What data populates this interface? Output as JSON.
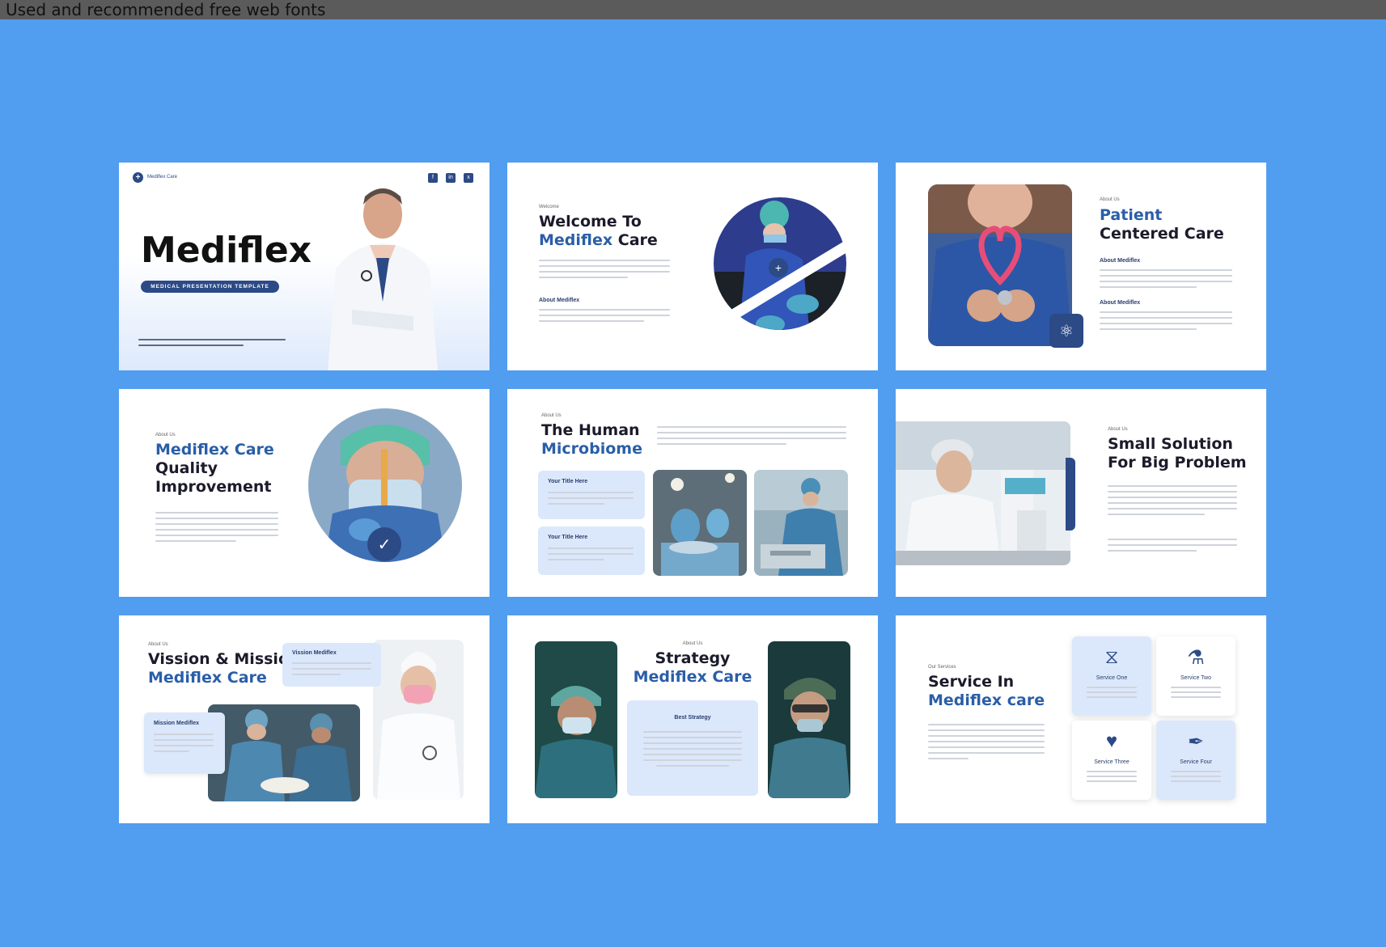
{
  "header": {
    "title": "Used and recommended free web fonts"
  },
  "colors": {
    "background": "#519df0",
    "brand_blue": "#2a5ea8",
    "navy": "#2c4a86",
    "card_tint": "#dbe8fb"
  },
  "s1": {
    "brand": "Mediflex Care",
    "title": "Mediflex",
    "pill": "MEDICAL PRESENTATION TEMPLATE",
    "social": [
      "f",
      "in",
      "x"
    ]
  },
  "s2": {
    "kicker": "Welcome",
    "title_line1": "Welcome To",
    "title_blue": "Mediflex",
    "title_rest": " Care",
    "about": "About Mediflex"
  },
  "s3": {
    "kicker": "About Us",
    "title_line1": "Patient",
    "title_line2": "Centered Care",
    "sub1": "About Mediflex",
    "sub2": "About Mediflex"
  },
  "s4": {
    "kicker": "About Us",
    "title_line1": "Mediflex Care",
    "title_line2": "Quality",
    "title_line3": "Improvement"
  },
  "s5": {
    "kicker": "About Us",
    "title_line1": "The Human",
    "title_line2": "Microbiome",
    "card1": "Your Title Here",
    "card2": "Your Title Here"
  },
  "s6": {
    "kicker": "About Us",
    "title_line1": "Small Solution",
    "title_line2": "For Big Problem"
  },
  "s7": {
    "kicker": "About Us",
    "title_line1": "Vission & Mission",
    "title_line2": "Mediflex Care",
    "vision": "Vission Mediflex",
    "mission": "Mission Mediflex"
  },
  "s8": {
    "kicker": "About Us",
    "title_line1": "Strategy",
    "title_line2": "Mediflex Care",
    "card": "Best Strategy"
  },
  "s9": {
    "kicker": "Our Services",
    "title_line1": "Service In",
    "title_line2": "Mediflex care",
    "services": [
      "Service One",
      "Service Two",
      "Service Three",
      "Service Four"
    ]
  }
}
